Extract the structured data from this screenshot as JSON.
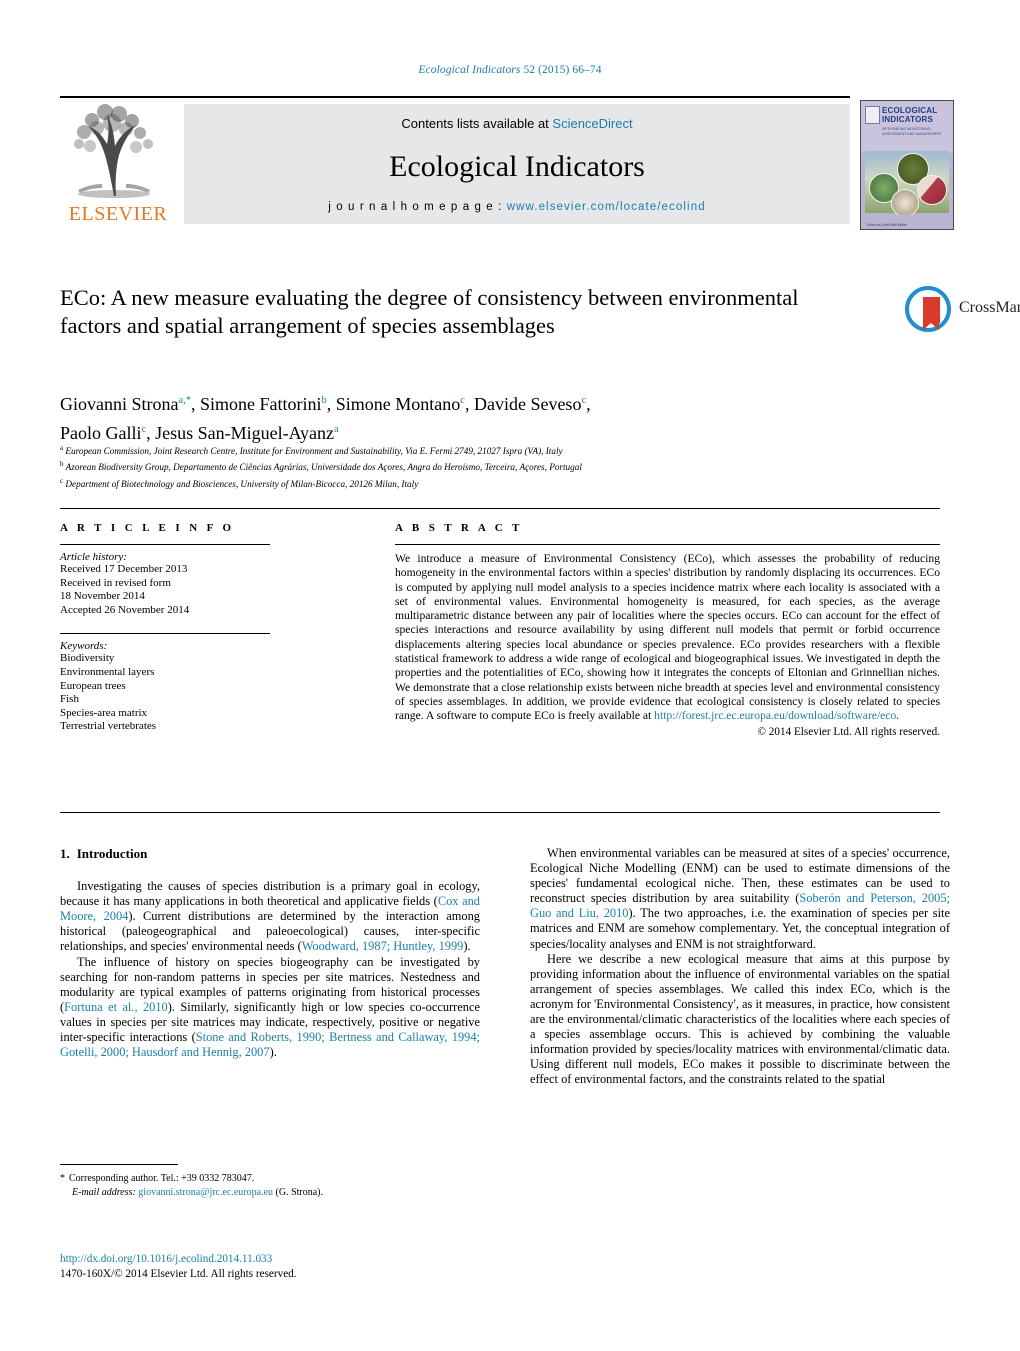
{
  "running_head": {
    "journal": "Ecological Indicators",
    "volume_info": " 52 (2015) 66–74"
  },
  "masthead": {
    "contents_prefix": "Contents lists available at ",
    "sciencedirect": "ScienceDirect",
    "journal_title": "Ecological Indicators",
    "homepage_prefix": "j o u r n a l   h o m e p a g e :  ",
    "homepage_url": "www.elsevier.com/locate/ecolind",
    "publisher": "ELSEVIER"
  },
  "cover": {
    "title": "ECOLOGICAL INDICATORS",
    "subtitle": "INTEGRATING MONITORING, ASSESSMENT AND MANAGEMENT",
    "footer": "Editor-in-Chief\nFelix Müller"
  },
  "article": {
    "title": "ECo: A new measure evaluating the degree of consistency between environmental factors and spatial arrangement of species assemblages",
    "authors_line1_a": "Giovanni Strona",
    "authors_line1_a_sup": "a,*",
    "authors_line1_b": ", Simone Fattorini",
    "authors_line1_b_sup": "b",
    "authors_line1_c": ", Simone Montano",
    "authors_line1_c_sup": "c",
    "authors_line1_d": ", Davide Seveso",
    "authors_line1_d_sup": "c",
    "authors_line1_end": ",",
    "authors_line2_a": "Paolo Galli",
    "authors_line2_a_sup": "c",
    "authors_line2_b": ", Jesus San-Miguel-Ayanz",
    "authors_line2_b_sup": "a",
    "affiliations": [
      {
        "sup": "a",
        "text": "European Commission, Joint Research Centre, Institute for Environment and Sustainability, Via E. Fermi 2749, 21027 Ispra (VA), Italy"
      },
      {
        "sup": "b",
        "text": "Azorean Biodiversity Group, Departamento de Ciências Agrárias, Universidade dos Açores, Angra do Heroísmo, Terceira, Açores, Portugal"
      },
      {
        "sup": "c",
        "text": "Department of Biotechnology and Biosciences, University of Milan-Bicocca, 20126 Milan, Italy"
      }
    ],
    "crossmark_label": "CrossMark"
  },
  "article_info": {
    "heading": "A R T I C L E    I N F O",
    "history_label": "Article history:",
    "history": [
      "Received 17 December 2013",
      "Received in revised form",
      "18 November 2014",
      "Accepted 26 November 2014"
    ],
    "keywords_label": "Keywords:",
    "keywords": [
      "Biodiversity",
      "Environmental layers",
      "European trees",
      "Fish",
      "Species-area matrix",
      "Terrestrial vertebrates"
    ]
  },
  "abstract": {
    "heading": "A B S T R A C T",
    "part1": "We introduce a measure of Environmental Consistency (ECo), which assesses the probability of reducing homogeneity in the environmental factors within a species' distribution by randomly displacing its occurrences. ECo is computed by applying null model analysis to a species incidence matrix where each locality is associated with a set of environmental values. Environmental homogeneity is measured, for each species, as the average multiparametric distance between any pair of localities where the species occurs. ECo can account for the effect of species interactions and resource availability by using different null models that permit or forbid occurrence displacements altering species local abundance or species prevalence. ECo provides researchers with a flexible statistical framework to address a wide range of ecological and biogeographical issues. We investigated in depth the properties and the potentialities of ECo, showing how it integrates the concepts of Eltonian and Grinnellian niches. We demonstrate that a close relationship exists between niche breadth at species level and environmental consistency of species assemblages. In addition, we provide evidence that ecological consistency is closely related to species range. A software to compute ECo is freely available at ",
    "link": "http://forest.jrc.ec.europa.eu/download/software/eco",
    "part2": ".",
    "copyright": "© 2014 Elsevier Ltd. All rights reserved."
  },
  "body": {
    "section_number": "1.",
    "section_title": "Introduction",
    "left_paragraphs": [
      {
        "segments": [
          {
            "t": "Investigating the causes of species distribution is a primary goal in ecology, because it has many applications in both theoretical and applicative fields (",
            "ref": false
          },
          {
            "t": "Cox and Moore, 2004",
            "ref": true
          },
          {
            "t": "). Current distributions are determined by the interaction among historical (paleogeographical and paleoecological) causes, inter-specific relationships, and species' environmental needs (",
            "ref": false
          },
          {
            "t": "Woodward, 1987; Huntley, 1999",
            "ref": true
          },
          {
            "t": ").",
            "ref": false
          }
        ]
      },
      {
        "segments": [
          {
            "t": "The influence of history on species biogeography can be investigated by searching for non-random patterns in species per site matrices. Nestedness and modularity are typical examples of patterns originating from historical processes (",
            "ref": false
          },
          {
            "t": "Fortuna et al., 2010",
            "ref": true
          },
          {
            "t": "). Similarly, significantly high or low species co-occurrence values in species per site matrices may indicate, respectively, positive or negative inter-specific interactions (",
            "ref": false
          },
          {
            "t": "Stone and Roberts, 1990; Bertness and Callaway, 1994; Gotelli, 2000; Hausdorf and Hennig, 2007",
            "ref": true
          },
          {
            "t": ").",
            "ref": false
          }
        ]
      }
    ],
    "right_paragraphs": [
      {
        "segments": [
          {
            "t": "When environmental variables can be measured at sites of a species' occurrence, Ecological Niche Modelling (ENM) can be used to estimate dimensions of the species' fundamental ecological niche. Then, these estimates can be used to reconstruct species distribution by area suitability (",
            "ref": false
          },
          {
            "t": "Soberón and Peterson, 2005; Guo and Liu, 2010",
            "ref": true
          },
          {
            "t": "). The two approaches, i.e. the examination of species per site matrices and ENM are somehow complementary. Yet, the conceptual integration of species/locality analyses and ENM is not straightforward.",
            "ref": false
          }
        ]
      },
      {
        "segments": [
          {
            "t": "Here we describe a new ecological measure that aims at this purpose by providing information about the influence of environmental variables on the spatial arrangement of species assemblages. We called this index ECo, which is the acronym for 'Environmental Consistency', as it measures, in practice, how consistent are the environmental/climatic characteristics of the localities where each species of a species assemblage occurs. This is achieved by combining the valuable information provided by species/locality matrices with environmental/climatic data. Using different null models, ECo makes it possible to discriminate between the effect of environmental factors, and the constraints related to the spatial",
            "ref": false
          }
        ]
      }
    ]
  },
  "footnote": {
    "star": "*",
    "corresponding": "Corresponding author. Tel.: +39 0332 783047.",
    "email_label": "E-mail address:",
    "email": "giovanni.strona@jrc.ec.europa.eu",
    "email_suffix": " (G. Strona)."
  },
  "doi_block": {
    "doi": "http://dx.doi.org/10.1016/j.ecolind.2014.11.033",
    "issn_line": "1470-160X/© 2014 Elsevier Ltd. All rights reserved."
  },
  "colors": {
    "link": "#1a7fa8",
    "elsevier_orange": "#e87722",
    "crossmark_blue": "#1f8fcf",
    "crossmark_red": "#d93b2b"
  }
}
